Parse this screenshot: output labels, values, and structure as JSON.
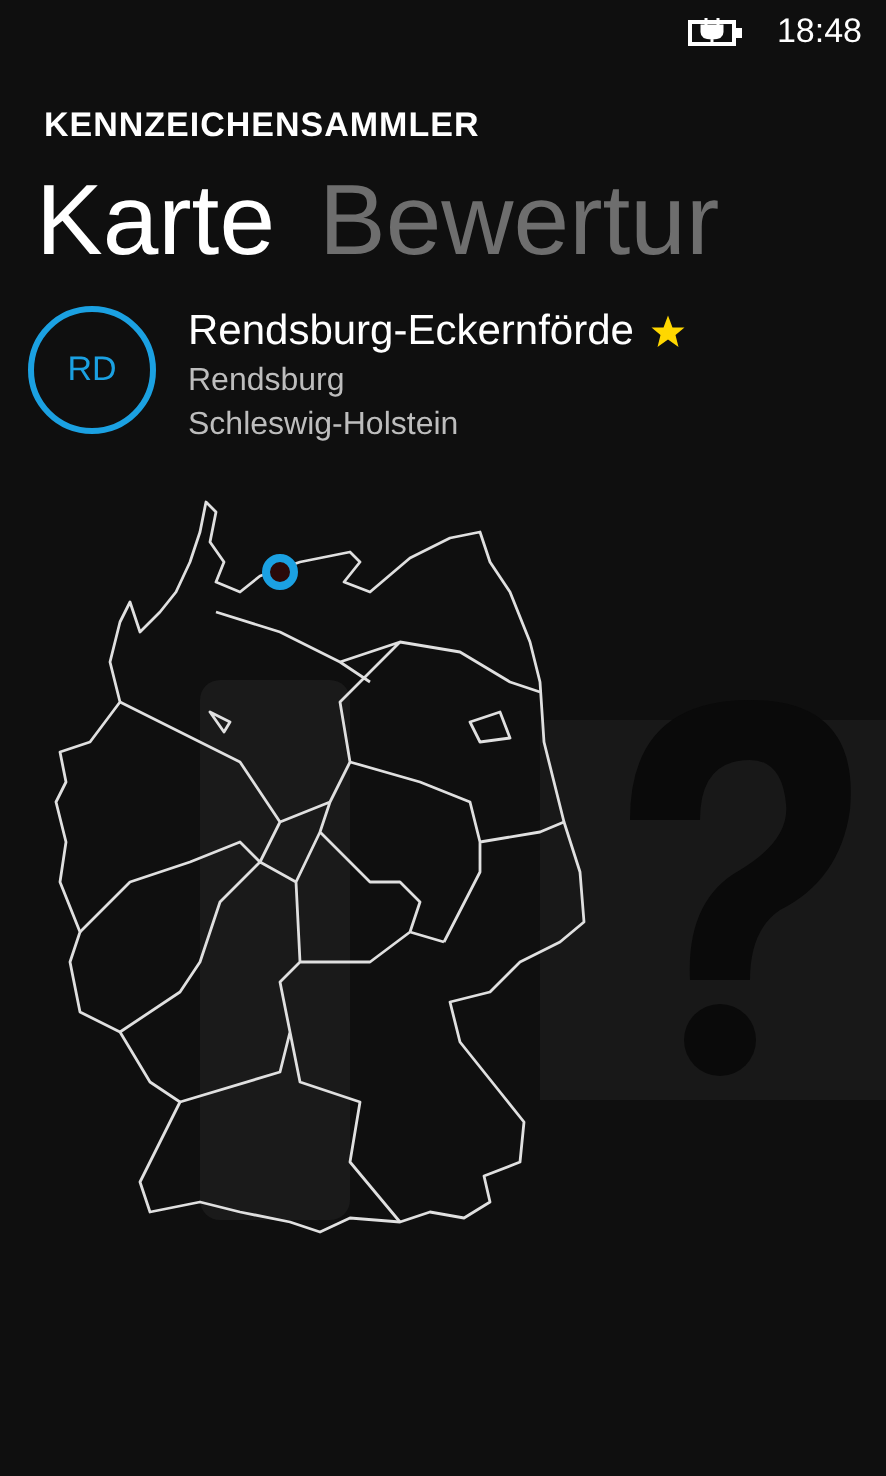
{
  "status_bar": {
    "time": "18:48"
  },
  "app_title": "KENNZEICHENSAMMLER",
  "pivot": [
    {
      "label": "Karte",
      "selected": true
    },
    {
      "label": "Bewertur",
      "selected": false
    }
  ],
  "plate": {
    "code": "RD",
    "name": "Rendsburg-Eckernförde",
    "favorite": true,
    "city": "Rendsburg",
    "state": "Schleswig-Holstein"
  }
}
